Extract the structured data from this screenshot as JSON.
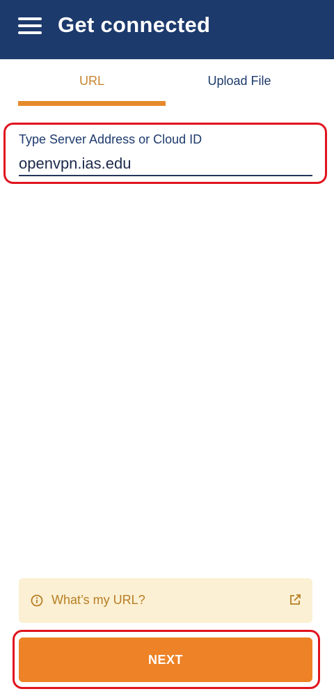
{
  "header": {
    "title": "Get connected",
    "menu_icon": "menu-icon"
  },
  "tabs": [
    {
      "label": "URL",
      "active": true
    },
    {
      "label": "Upload File",
      "active": false
    }
  ],
  "server_field": {
    "label": "Type Server Address or Cloud ID",
    "value": "openvpn.ias.edu"
  },
  "help": {
    "text": "What’s my URL?",
    "icon": "info-icon",
    "trailing_icon": "external-link-icon"
  },
  "next_button": {
    "label": "NEXT"
  },
  "colors": {
    "header_bg": "#1d3a6c",
    "accent": "#ee8226",
    "help_bg": "#fbf0d3",
    "highlight": "#e0141e"
  }
}
